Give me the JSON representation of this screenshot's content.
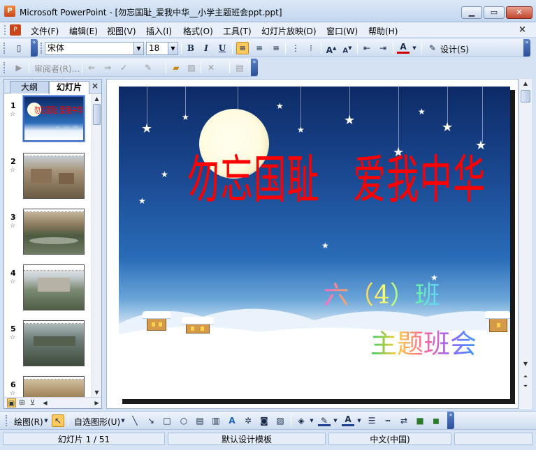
{
  "window": {
    "title": "Microsoft PowerPoint - [勿忘国耻_爱我中华__小学主题班会ppt.ppt]",
    "app_icon": "powerpoint-icon",
    "min_glyph": "▁",
    "max_glyph": "▭",
    "close_glyph": "✕"
  },
  "menu": {
    "items": [
      "文件(F)",
      "编辑(E)",
      "视图(V)",
      "插入(I)",
      "格式(O)",
      "工具(T)",
      "幻灯片放映(D)",
      "窗口(W)",
      "帮助(H)"
    ],
    "close_glyph": "×"
  },
  "formatting_toolbar": {
    "font_name": "宋体",
    "font_size": "18",
    "bold": "B",
    "italic": "I",
    "underline": "U",
    "design_label": "设计(S)",
    "font_color": "#cc0000"
  },
  "review_toolbar": {
    "reviewer_label": "审阅者(R)..."
  },
  "left_pane": {
    "tab_outline": "大纲",
    "tab_slides": "幻灯片",
    "close_glyph": "×",
    "slide_numbers": [
      "1",
      "2",
      "3",
      "4",
      "5",
      "6"
    ],
    "selected_slide": 1,
    "thumb_1_title": "勿忘国耻 爱我中华",
    "thumb_1_sub": "六（4）班"
  },
  "slide": {
    "title": "勿忘国耻　爱我中华",
    "subtitle_line1": "六（4）班",
    "subtitle_line2": "主题班会"
  },
  "drawing_toolbar": {
    "draw_label": "绘图(R)",
    "autoshapes_label": "自选图形(U)"
  },
  "status": {
    "slide_info": "幻灯片 1 / 51",
    "template": "默认设计模板",
    "language": "中文(中国)"
  },
  "colors": {
    "title_red": "#ff0000",
    "night_sky": "#1b4a93",
    "accent_blue": "#3a67c2"
  }
}
